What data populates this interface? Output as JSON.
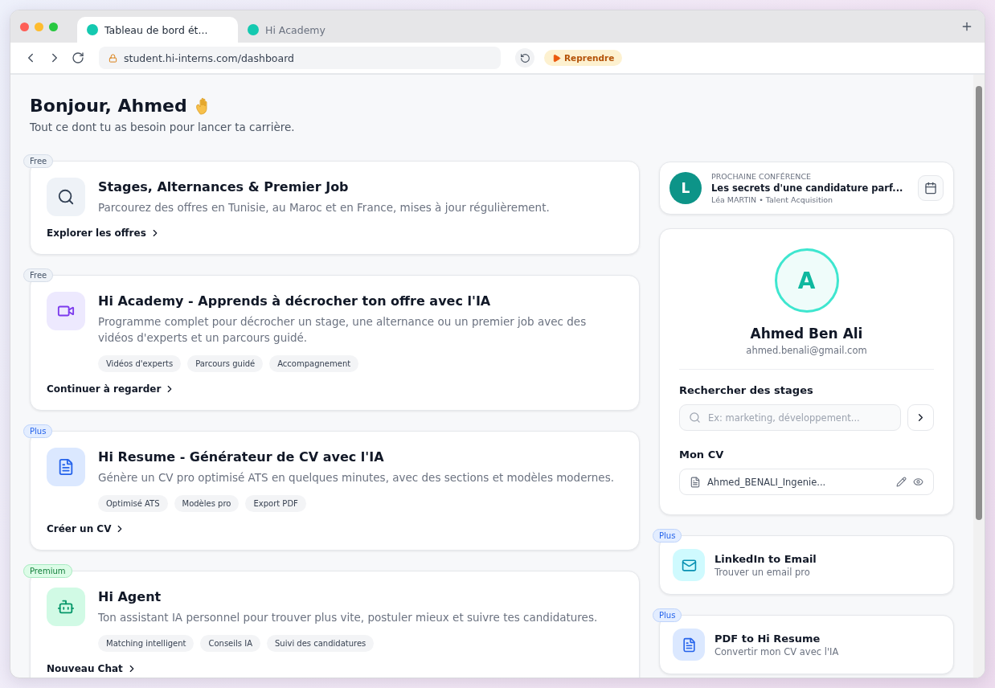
{
  "browser": {
    "tabs": [
      {
        "title": "Tableau de bord ét...",
        "selected": true
      },
      {
        "title": "Hi Academy",
        "selected": false
      }
    ],
    "url": "student.hi-interns.com/dashboard",
    "resume_button": "Reprendre"
  },
  "greeting": {
    "title": "Bonjour, Ahmed",
    "subtitle": "Tout ce dont tu as besoin pour lancer ta carrière."
  },
  "services": [
    {
      "badge": {
        "label": "Free",
        "kind": "free"
      },
      "kind": "search",
      "title": "Stages, Alternances & Premier Job",
      "description": "Parcourez des offres en Tunisie, au Maroc et en France, mises à jour régulièrement.",
      "link": "Explorer les offres"
    },
    {
      "badge": {
        "label": "Free",
        "kind": "free"
      },
      "kind": "video",
      "title": "Hi Academy - Apprends à décrocher ton offre avec l'IA",
      "description": "Programme complet pour décrocher un stage, une alternance ou un premier job avec des vidéos d'experts et un parcours guidé.",
      "tags": [
        "Vidéos d'experts",
        "Parcours guidé",
        "Accompagnement"
      ],
      "link": "Continuer à regarder"
    },
    {
      "badge": {
        "label": "Plus",
        "kind": "plus"
      },
      "kind": "document",
      "title": "Hi Resume - Générateur de CV avec l'IA",
      "description": "Génère un CV pro optimisé ATS en quelques minutes, avec des sections et modèles modernes.",
      "tags": [
        "Optimisé ATS",
        "Modèles pro",
        "Export PDF"
      ],
      "link": "Créer un CV"
    },
    {
      "badge": {
        "label": "Premium",
        "kind": "premium"
      },
      "kind": "robot",
      "title": "Hi Agent",
      "description": "Ton assistant IA personnel pour trouver plus vite, postuler mieux et suivre tes candidatures.",
      "tags": [
        "Matching intelligent",
        "Conseils IA",
        "Suivi des candidatures"
      ],
      "link": "Nouveau Chat"
    }
  ],
  "conference": {
    "avatar": "L",
    "eyebrow": "PROCHAINE CONFÉRENCE",
    "title": "Les secrets d'une candidature parf...",
    "speaker": "Léa MARTIN • Talent Acquisition"
  },
  "profile": {
    "avatar": "A",
    "name": "Ahmed Ben Ali",
    "email": "ahmed.benali@gmail.com",
    "search_title": "Rechercher des stages",
    "search_placeholder": "Ex: marketing, développement...",
    "cv_title": "Mon CV",
    "cv_file": "Ahmed_BENALI_Ingenie..."
  },
  "tools": [
    {
      "badge": {
        "label": "Plus",
        "kind": "plus"
      },
      "kind": "mail",
      "title": "LinkedIn to Email",
      "subtitle": "Trouver un email pro"
    },
    {
      "badge": {
        "label": "Plus",
        "kind": "plus"
      },
      "kind": "document",
      "title": "PDF to Hi Resume",
      "subtitle": "Convertir mon CV avec l'IA"
    }
  ]
}
